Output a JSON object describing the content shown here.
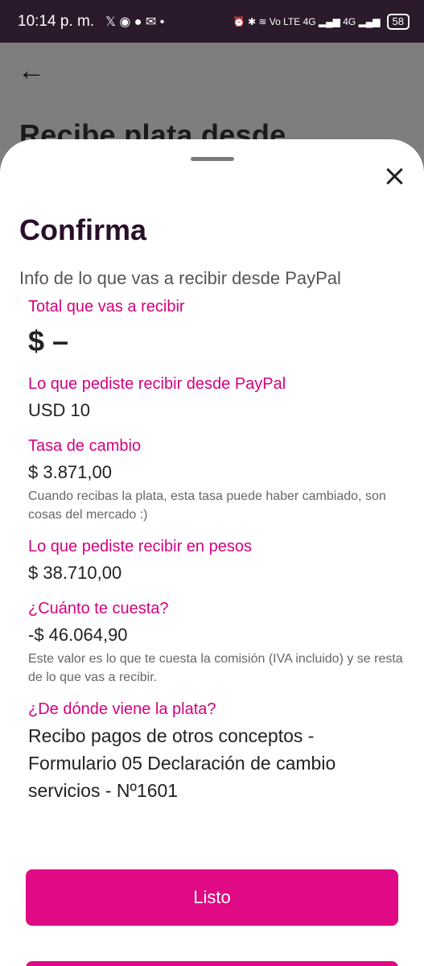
{
  "status": {
    "time": "10:14 p. m.",
    "notif_icons": "𝕏 ◉ ● ✉ •",
    "right_icons": "⏰ ✱ ≋ Vo LTE 4G ▂▄▆ 4G ▂▄▆",
    "battery": "58"
  },
  "background": {
    "back_glyph": "←",
    "title": "Recibe plata desde"
  },
  "sheet": {
    "title": "Confirma",
    "subtitle": "Info de lo que vas a recibir desde PayPal",
    "total_label": "Total que vas a recibir",
    "total_value": "$ –",
    "requested_label": "Lo que pediste recibir desde PayPal",
    "requested_value": "USD 10",
    "rate_label": "Tasa de cambio",
    "rate_value": "$ 3.871,00",
    "rate_note": "Cuando recibas la plata, esta tasa puede haber cambiado, son cosas del mercado :)",
    "pesos_label": "Lo que pediste recibir en pesos",
    "pesos_value": "$ 38.710,00",
    "cost_label": "¿Cuánto te cuesta?",
    "cost_value": "-$ 46.064,90",
    "cost_note": "Este valor es lo que te cuesta la comisión (IVA incluido) y se resta de lo que vas a recibir.",
    "origin_label": "¿De dónde viene la plata?",
    "origin_value": "Recibo pagos de otros conceptos - Formulario 05 Declaración de cambio servicios - Nº1601",
    "button_label": "Listo"
  },
  "colors": {
    "accent": "#d5007f",
    "button": "#df0a84",
    "status_bar": "#2a1a2c"
  }
}
